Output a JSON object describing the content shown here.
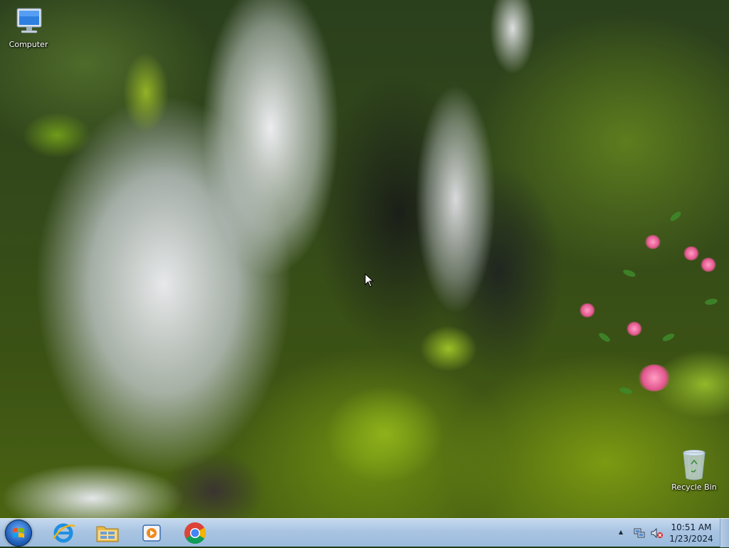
{
  "desktop": {
    "icons": [
      {
        "label": "Computer",
        "icon": "computer-icon"
      },
      {
        "label": "Recycle Bin",
        "icon": "recycle-bin-icon"
      }
    ],
    "wallpaper": "waterfall"
  },
  "taskbar": {
    "start": {
      "icon": "windows-logo-icon"
    },
    "pinned": [
      {
        "name": "Internet Explorer",
        "icon": "internet-explorer-icon"
      },
      {
        "name": "Windows Explorer",
        "icon": "file-explorer-icon"
      },
      {
        "name": "Windows Media Player",
        "icon": "media-player-icon"
      },
      {
        "name": "Google Chrome",
        "icon": "chrome-icon"
      }
    ],
    "tray": {
      "icons": [
        "show-hidden-icons-arrow",
        "network-icon",
        "volume-muted-icon"
      ],
      "clock": {
        "time": "10:51 AM",
        "date": "1/23/2024"
      }
    }
  },
  "colors": {
    "taskbar": "#a9c4e2",
    "start_orb": "#1f5fb8"
  }
}
